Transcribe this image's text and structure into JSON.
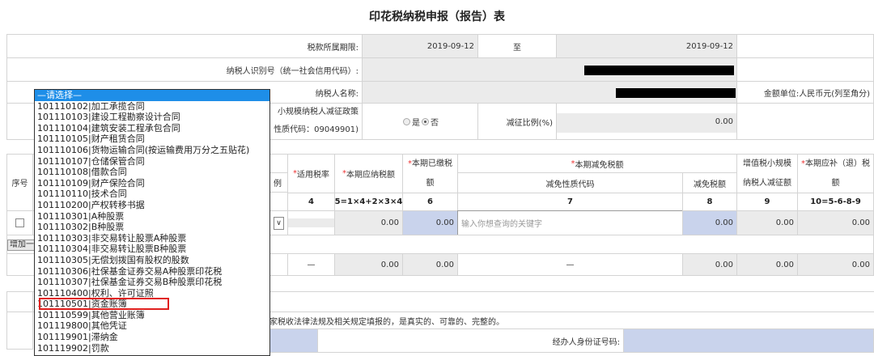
{
  "title": "印花税纳税申报（报告）表",
  "info": {
    "period_label": "税款所属期限:",
    "period_from": "2019-09-12",
    "period_to_sep": "至",
    "period_to": "2019-09-12",
    "taxpayer_id_label": "纳税人识别号（统一社会信用代码）:",
    "taxpayer_name_label": "纳税人名称:",
    "amount_unit": "金额单位:人民币元(列至角分)",
    "policy_line1": "小规模纳税人减征政策",
    "policy_line2": "性质代码：09049901)",
    "radio_yes": "是",
    "radio_no": "否",
    "radio_selected": "否",
    "reduction_ratio_label": "减征比例(%)",
    "reduction_ratio": "0.00"
  },
  "table": {
    "headers": {
      "seq": "序号",
      "col_partial": "例",
      "rate": "适用税率",
      "payable": "本期应纳税额",
      "paid_a": "本期已缴税",
      "paid_b": "额",
      "reduction": "本期减免税额",
      "reduction_code": "减免性质代码",
      "reduction_amount": "减免税额",
      "vat_a": "增值税小规模",
      "vat_b": "纳税人减征额",
      "refund_a": "本期应补（退）税",
      "refund_b": "额",
      "required_mark": "*"
    },
    "col_numbers": [
      "4",
      "5=1×4+2×3×4",
      "6",
      "7",
      "8",
      "9",
      "10=5-6-8-9"
    ],
    "row": {
      "payable": "0.00",
      "paid": "0.00",
      "code_placeholder": "输入你想查询的关键字",
      "reduction_amount": "0.00",
      "vat": "0.00",
      "refund": "0.00"
    },
    "add_row_button": "增加一",
    "total": {
      "rate": "—",
      "payable": "0.00",
      "paid": "0.00",
      "code": "—",
      "reduction_amount": "0.00",
      "vat": "0.00",
      "refund": "0.00"
    }
  },
  "declaration": "家税收法律法规及相关规定填报的，是真实的、可靠的、完整的。",
  "agent_id_label": "经办人身份证号码:",
  "dropdown": {
    "placeholder": "—请选择—",
    "highlighted": "101110501|资金账簿",
    "options": [
      "101110102|加工承揽合同",
      "101110103|建设工程勘察设计合同",
      "101110104|建筑安装工程承包合同",
      "101110105|财产租赁合同",
      "101110106|货物运输合同(按运输费用万分之五贴花)",
      "101110107|仓储保管合同",
      "101110108|借款合同",
      "101110109|财产保险合同",
      "101110110|技术合同",
      "101110200|产权转移书据",
      "101110301|A种股票",
      "101110302|B种股票",
      "101110303|非交易转让股票A种股票",
      "101110304|非交易转让股票B种股票",
      "101110305|无偿划拨国有股权的股数",
      "101110306|社保基金证券交易A种股票印花税",
      "101110307|社保基金证券交易B种股票印花税",
      "101110400|权利、许可证照",
      "101110501|资金账簿",
      "101110599|其他营业账簿",
      "101119800|其他凭证",
      "101119901|滞纳金",
      "101119902|罚款"
    ]
  }
}
